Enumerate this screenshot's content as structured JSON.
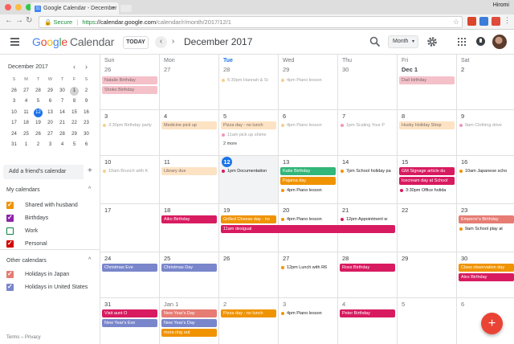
{
  "browser": {
    "tab_title": "Google Calendar - December",
    "tab_favicon": "31",
    "profile_name": "Hiromi",
    "secure_label": "Secure",
    "url_scheme": "https",
    "url_host": "://calendar.google.com",
    "url_path": "/calendar/r/month/2017/12/1"
  },
  "header": {
    "logo_letters": [
      "G",
      "o",
      "o",
      "g",
      "l",
      "e"
    ],
    "logo_app": "Calendar",
    "today_label": "TODAY",
    "prev_label": "‹",
    "next_label": "›",
    "current_month": "December 2017",
    "view_label": "Month",
    "view_caret": "▾"
  },
  "mini_calendar": {
    "title": "December 2017",
    "prev": "‹",
    "next": "›",
    "dow": [
      "S",
      "M",
      "T",
      "W",
      "T",
      "F",
      "S"
    ],
    "rows": [
      [
        "26",
        "27",
        "28",
        "29",
        "30",
        "1",
        "2"
      ],
      [
        "3",
        "4",
        "5",
        "6",
        "7",
        "8",
        "9"
      ],
      [
        "10",
        "11",
        "12",
        "13",
        "14",
        "15",
        "16"
      ],
      [
        "17",
        "18",
        "19",
        "20",
        "21",
        "22",
        "23"
      ],
      [
        "24",
        "25",
        "26",
        "27",
        "28",
        "29",
        "30"
      ],
      [
        "31",
        "1",
        "2",
        "3",
        "4",
        "5",
        "6"
      ]
    ],
    "today": "12",
    "selected": "1"
  },
  "sidebar": {
    "add_friend_placeholder": "Add a friend's calendar",
    "add_plus": "+",
    "my_calendars_title": "My calendars",
    "my_calendars": [
      {
        "label": "Shared with husband",
        "color": "#f09300",
        "checked": true
      },
      {
        "label": "Birthdays",
        "color": "#8e24aa",
        "checked": true
      },
      {
        "label": "Work",
        "color": "#0b8043",
        "checked": false
      },
      {
        "label": "Personal",
        "color": "#d50000",
        "checked": true
      }
    ],
    "other_calendars_title": "Other calendars",
    "other_calendars": [
      {
        "label": "Holidays in Japan",
        "color": "#e67c73",
        "checked": true
      },
      {
        "label": "Holidays in United States",
        "color": "#7986cb",
        "checked": true
      }
    ],
    "footer": "Terms – Privacy",
    "chevron": "^"
  },
  "calendar": {
    "dow": [
      "Sun",
      "Mon",
      "Tue",
      "Wed",
      "Thu",
      "Fri",
      "Sat"
    ],
    "weeks": [
      {
        "days": [
          "26",
          "27",
          "28",
          "29",
          "30",
          "Dec 1",
          "2"
        ]
      },
      {
        "days": [
          "3",
          "4",
          "5",
          "6",
          "7",
          "8",
          "9"
        ]
      },
      {
        "days": [
          "10",
          "11",
          "12",
          "13",
          "14",
          "15",
          "16"
        ]
      },
      {
        "days": [
          "17",
          "18",
          "19",
          "20",
          "21",
          "22",
          "23"
        ]
      },
      {
        "days": [
          "24",
          "25",
          "26",
          "27",
          "28",
          "29",
          "30"
        ]
      },
      {
        "days": [
          "31",
          "Jan 1",
          "2",
          "3",
          "4",
          "5",
          "6"
        ]
      }
    ],
    "events": {
      "natalie": "Natalie Birthday",
      "shoko": "Shoko Birthday",
      "hannah": "6:30pm Hannah & Si",
      "piano": "4pm Piano lesson",
      "dad": "Dad birthday",
      "bday_party": "3:30pm Birthday party",
      "medicine": "Medicine pick up",
      "pizza_nolunch": "Pizza day - no lunch",
      "pickup": "11am pick up shime",
      "more2": "2 more",
      "scaling": "1pm Scaling Your P",
      "husky": "Husky Holiday Shop",
      "clothing": "9am Clothing drive",
      "brunch": "10am Brunch with K",
      "library": "Library due",
      "documentation": "1pm Documentation",
      "katie": "Katie Birthday",
      "pajama": "Pajama day",
      "piano_bold": "4pm Piano lesson",
      "school_holiday": "7pm School holiday pa",
      "gm_signage": "GM Signage article du",
      "icecream": "Icecream day at School",
      "office_holiday": "3:30pm Office holida",
      "japanese": "10am Japanese scho",
      "aiko": "Aiko Birthday",
      "grilled": "Grilled Cheese day - no",
      "appointment": "12pm Appointment w",
      "desigual": "11am desigual",
      "emperor": "Emperor's Birthday",
      "school_play": "9am School play at",
      "xmas_eve": "Christmas Eve",
      "xmas_day": "Christmas Day",
      "lunch_r6": "12pm Lunch with R6",
      "ross": "Ross Birthday",
      "class_obs": "Class observation day",
      "alex": "Alex Birthday",
      "visit": "Visit aunt O",
      "nye": "New Year's Eve",
      "nyd": "New Year's Day",
      "nyd2": "New Year's Day",
      "mora": "mora ring out",
      "pizza_jan": "Pizza day - no lunch",
      "piano_jan": "4pm Piano lesson",
      "peter": "Peter Birthday"
    }
  },
  "fab_label": "+",
  "colors": {
    "today_blue": "#1a73e8",
    "fab_red": "#ea4335",
    "birthday_pink": "#f4c1c9",
    "orange": "#f09300",
    "crimson": "#d81b60",
    "green": "#33b679",
    "lavender": "#7986cb",
    "salmon": "#e67c73"
  }
}
